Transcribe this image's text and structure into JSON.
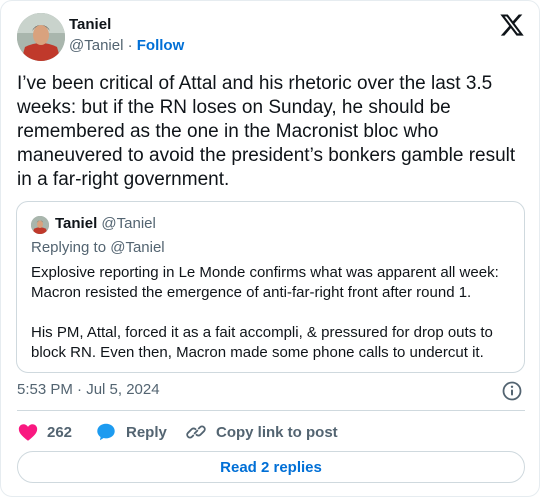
{
  "author": {
    "name": "Taniel",
    "handle": "@Taniel",
    "separator": "·",
    "follow_label": "Follow"
  },
  "brand_icon": "x-logo-icon",
  "tweet": {
    "text": "I’ve been critical of Attal and his rhetoric over the last 3.5 weeks: but if the RN loses on Sunday, he should be remembered as the one in the Macronist bloc who maneuvered to avoid the president’s bonkers gamble result in a far-right government.",
    "timestamp": "5:53 PM · Jul 5, 2024"
  },
  "quoted_tweet": {
    "name": "Taniel",
    "handle": "@Taniel",
    "replying_to": "Replying to @Taniel",
    "paragraph_1": "Explosive reporting in Le Monde confirms what was apparent all week: Macron resisted the emergence of anti-far-right front after round 1.",
    "paragraph_2": "His PM, Attal, forced it as a fait accompli, & pressured for drop outs to block RN. Even then, Macron made some phone calls to undercut it."
  },
  "actions": {
    "like_count": "262",
    "reply_label": "Reply",
    "copy_link_label": "Copy link to post"
  },
  "read_replies_label": "Read 2 replies",
  "colors": {
    "text": "#0f1419",
    "secondary": "#536471",
    "link": "#006fd6",
    "like": "#f91880",
    "reply": "#1d9bf0",
    "border": "#cfd9de"
  }
}
